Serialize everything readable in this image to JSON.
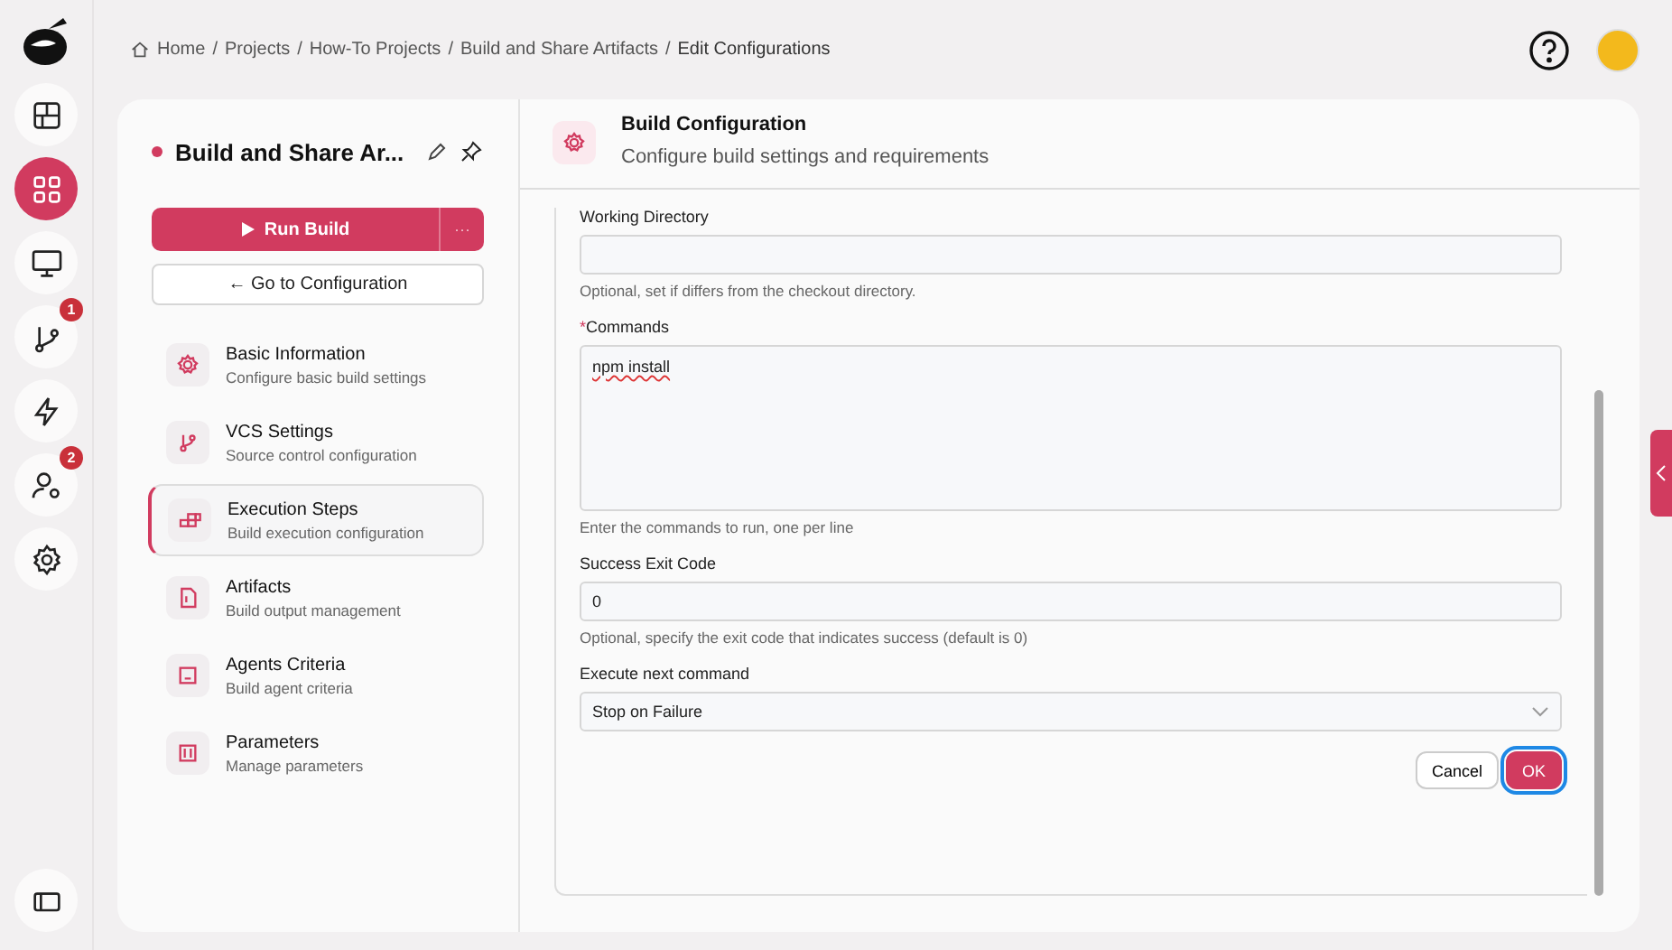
{
  "rail": {
    "items": [
      {
        "kind": "layout",
        "selected": false
      },
      {
        "kind": "apps",
        "selected": true
      },
      {
        "kind": "monitor",
        "selected": false
      },
      {
        "kind": "branch",
        "selected": false,
        "badge": "1"
      },
      {
        "kind": "bolt",
        "selected": false
      },
      {
        "kind": "user-gear",
        "selected": false,
        "badge": "2"
      },
      {
        "kind": "gear",
        "selected": false
      }
    ]
  },
  "breadcrumb_separator": "/",
  "breadcrumb": [
    "Home",
    "Projects",
    "How-To Projects",
    "Build and Share Artifacts",
    "Edit Configurations"
  ],
  "project": {
    "title": "Build and Share Ar...",
    "run_button": "Run Build",
    "more": "···",
    "config_button": "← Go to Configuration"
  },
  "steps": [
    {
      "kind": "gear",
      "title": "Basic Information",
      "subtitle": "Configure basic build settings",
      "selected": false
    },
    {
      "kind": "branch",
      "title": "VCS Settings",
      "subtitle": "Source control configuration",
      "selected": false
    },
    {
      "kind": "blocks",
      "title": "Execution Steps",
      "subtitle": "Build execution configuration",
      "selected": true
    },
    {
      "kind": "file",
      "title": "Artifacts",
      "subtitle": "Build output management",
      "selected": false
    },
    {
      "kind": "agent",
      "title": "Agents Criteria",
      "subtitle": "Build agent criteria",
      "selected": false
    },
    {
      "kind": "sliders",
      "title": "Parameters",
      "subtitle": "Manage parameters",
      "selected": false
    }
  ],
  "panel": {
    "title": "Build Configuration",
    "subtitle": "Configure build settings and requirements"
  },
  "fields": [
    {
      "kind": "input",
      "label": "Working Directory",
      "help": "Optional, set if differs from the checkout directory."
    },
    {
      "kind": "textarea",
      "label": "Commands",
      "required_mark": "*",
      "value": "npm install",
      "help": "Enter the commands to run, one per line"
    },
    {
      "kind": "input",
      "label": "Success Exit Code",
      "value": "0",
      "help": "Optional, specify the exit code that indicates success (default is 0)"
    },
    {
      "kind": "select",
      "label": "Execute next command",
      "value": "Stop on Failure"
    }
  ],
  "buttons": {
    "cancel": "Cancel",
    "ok": "OK"
  }
}
